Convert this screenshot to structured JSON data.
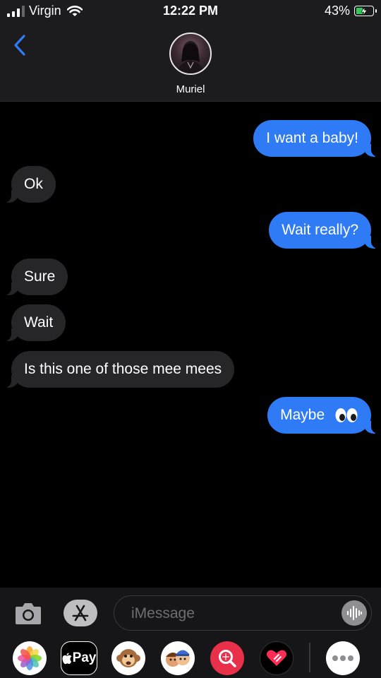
{
  "status_bar": {
    "carrier": "Virgin",
    "time": "12:22 PM",
    "battery_percent": "43%"
  },
  "header": {
    "contact_name": "Muriel"
  },
  "messages": [
    {
      "direction": "outgoing",
      "text": "I want a baby!"
    },
    {
      "direction": "incoming",
      "text": "Ok"
    },
    {
      "direction": "outgoing",
      "text": "Wait really?"
    },
    {
      "direction": "incoming",
      "text": "Sure"
    },
    {
      "direction": "incoming",
      "text": "Wait"
    },
    {
      "direction": "incoming",
      "text": "Is this one of those mee mees"
    },
    {
      "direction": "outgoing",
      "text": "Maybe",
      "emoji": "eyes"
    }
  ],
  "composer": {
    "placeholder": "iMessage"
  },
  "app_drawer": {
    "apple_pay_label": "Pay",
    "items": [
      "photos-icon",
      "apple-pay-icon",
      "animoji-icon",
      "memoji-icon",
      "web-search-icon",
      "digital-touch-icon",
      "more-apps-icon"
    ]
  },
  "colors": {
    "outgoing_bubble": "#2f7bf6",
    "incoming_bubble": "#262628",
    "accent": "#2f7bf6"
  }
}
